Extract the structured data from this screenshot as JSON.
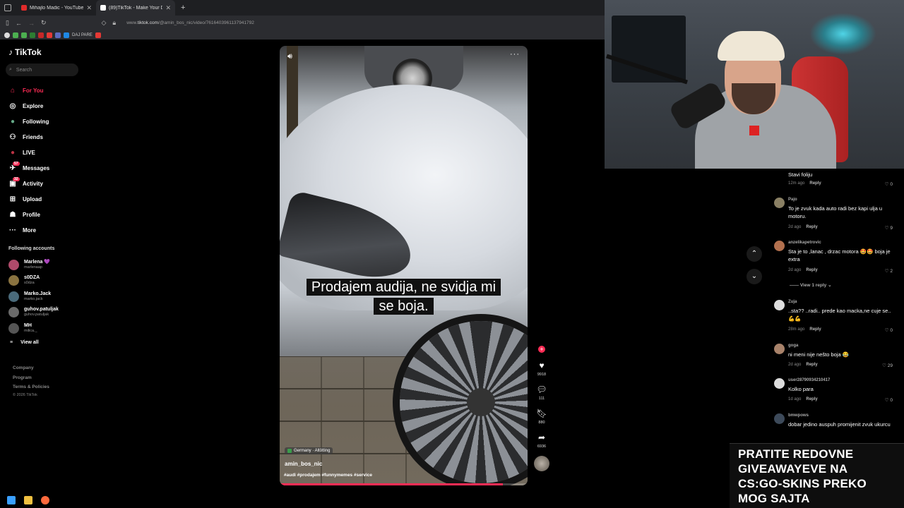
{
  "browser": {
    "tabs": [
      {
        "title": "Mihajlo Madic - YouTube",
        "active": false,
        "favicon_color": "#e02b2b"
      },
      {
        "title": "(89)TikTok - Make Your Day",
        "active": true,
        "favicon_color": "#ffffff"
      }
    ],
    "url_prefix": "www.",
    "url_domain": "tiktok.com",
    "url_path": "/@amin_bos_nic/video/7616403961137941792",
    "bookmark_label": "DAJ PARE"
  },
  "tiktok": {
    "logo": "TikTok",
    "search_placeholder": "Search",
    "nav": [
      {
        "label": "For You",
        "icon": "home-icon",
        "glyph": "⌂",
        "active": true
      },
      {
        "label": "Explore",
        "icon": "compass-icon",
        "glyph": "◎"
      },
      {
        "label": "Following",
        "icon": "following-avatar-icon",
        "glyph": "●"
      },
      {
        "label": "Friends",
        "icon": "friends-icon",
        "glyph": "👥"
      },
      {
        "label": "LIVE",
        "icon": "live-avatar-icon",
        "glyph": "●"
      },
      {
        "label": "Messages",
        "icon": "messages-icon",
        "glyph": "✈",
        "badge": "57"
      },
      {
        "label": "Activity",
        "icon": "activity-icon",
        "glyph": "▣",
        "badge": "32"
      },
      {
        "label": "Upload",
        "icon": "upload-icon",
        "glyph": "⊞"
      },
      {
        "label": "Profile",
        "icon": "profile-icon",
        "glyph": "☗"
      },
      {
        "label": "More",
        "icon": "more-icon",
        "glyph": "···"
      }
    ],
    "following_title": "Following accounts",
    "accounts": [
      {
        "name": "Marlena 💜",
        "handle": "marlenaap",
        "color": "#b04a6a"
      },
      {
        "name": "s0DZA",
        "handle": "s0dza",
        "color": "#8a7340"
      },
      {
        "name": "Marko.Jack",
        "handle": "marko.jack",
        "color": "#4a6a7a"
      },
      {
        "name": "guhov.patuljak",
        "handle": "guhov.patuljak",
        "color": "#6a6a6a"
      },
      {
        "name": "MH",
        "handle": "milica._",
        "color": "#555555"
      }
    ],
    "view_all": "View all",
    "footer": [
      "Company",
      "Program",
      "Terms & Policies"
    ],
    "copyright": "© 2026 TikTok"
  },
  "video": {
    "caption_line1": "Prodajem audija, ne svidja mi",
    "caption_line2": "se boja.",
    "location": "Germany · Altötting",
    "author": "amin_bos_nic",
    "hashtags": "#audi #prodajem #funnymemes #service",
    "progress": 0.9,
    "likes": "9918",
    "comments": "111",
    "saves": "880",
    "shares": "6936"
  },
  "comments": [
    {
      "user": "",
      "text": "Stavi foliju",
      "time": "12m ago",
      "likes": "0"
    },
    {
      "user": "Pajo",
      "text": "To je zvuk kada auto radi bez kapi ulja u motoru.",
      "time": "2d ago",
      "likes": "9"
    },
    {
      "user": "anzelikapetrovic",
      "text": "Sta je to ,lanac , drzac motora 🤩🤩 boja je extra",
      "time": "2d ago",
      "likes": "2"
    },
    {
      "user": "Zuja",
      "text": "..sta?? ..radi.. prede kao macka,ne cuje se..💪💪",
      "time": "28m ago",
      "likes": "0"
    },
    {
      "user": "goga",
      "text": "ni meni nije nešto boja 😂",
      "time": "2d ago",
      "likes": "29"
    },
    {
      "user": "user28790934210417",
      "text": "Kolko para",
      "time": "1d ago",
      "likes": "0"
    },
    {
      "user": "bmwpows",
      "text": "dobar jedino auspuh promijenit zvuk ukurcu",
      "time": "",
      "likes": ""
    }
  ],
  "reply_label": "Reply",
  "view_replies": "View 1 reply",
  "banner": {
    "line1": "PRATITE REDOVNE",
    "line2": "GIVEAWAYEVE NA",
    "line3": "CS:GO-SKINS PREKO",
    "line4": "MOG SAJTA"
  },
  "colors": {
    "accent": "#fe2c55",
    "background": "#000000"
  }
}
